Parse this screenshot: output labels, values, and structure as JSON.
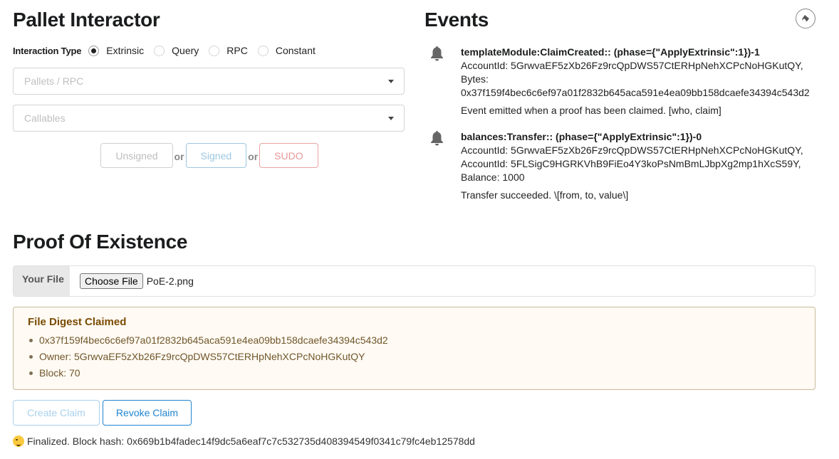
{
  "pallet_interactor": {
    "title": "Pallet Interactor",
    "interaction_type_label": "Interaction Type",
    "interaction_types": [
      {
        "label": "Extrinsic",
        "checked": true
      },
      {
        "label": "Query",
        "checked": false
      },
      {
        "label": "RPC",
        "checked": false
      },
      {
        "label": "Constant",
        "checked": false
      }
    ],
    "pallets_placeholder": "Pallets / RPC",
    "callables_placeholder": "Callables",
    "submit_buttons": {
      "unsigned": "Unsigned",
      "or1": "or",
      "signed": "Signed",
      "or2": "or",
      "sudo": "SUDO"
    }
  },
  "events": {
    "title": "Events",
    "clear_icon": "eraser-icon",
    "items": [
      {
        "icon": "bell-icon",
        "title": "templateModule:ClaimCreated:: (phase={\"ApplyExtrinsic\":1})-1",
        "lines": [
          "AccountId: 5GrwvaEF5zXb26Fz9rcQpDWS57CtERHpNehXCPcNoHGKutQY,",
          "Bytes:",
          "0x37f159f4bec6c6ef97a01f2832b645aca591e4ea09bb158dcaefe34394c543d2"
        ],
        "description": "Event emitted when a proof has been claimed. [who, claim]"
      },
      {
        "icon": "bell-icon",
        "title": "balances:Transfer:: (phase={\"ApplyExtrinsic\":1})-0",
        "lines": [
          "AccountId: 5GrwvaEF5zXb26Fz9rcQpDWS57CtERHpNehXCPcNoHGKutQY,",
          "AccountId: 5FLSigC9HGRKVhB9FiEo4Y3koPsNmBmLJbpXg2mp1hXcS59Y,",
          "Balance: 1000"
        ],
        "description": "Transfer succeeded. \\[from, to, value\\]"
      }
    ]
  },
  "proof_of_existence": {
    "title": "Proof Of Existence",
    "file_label": "Your File",
    "choose_file_label": "Choose File",
    "file_name": "PoE-2.png",
    "claimed": {
      "header": "File Digest Claimed",
      "items": [
        "0x37f159f4bec6c6ef97a01f2832b645aca591e4ea09bb158dcaefe34394c543d2",
        "Owner: 5GrwvaEF5zXb26Fz9rcQpDWS57CtERHpNehXCPcNoHGKutQY",
        "Block: 70"
      ]
    },
    "create_claim_label": "Create Claim",
    "revoke_claim_label": "Revoke Claim",
    "status_icon": "wink-emoji-icon",
    "status_text": "Finalized. Block hash: 0x669b1b4fadec14f9dc5a6eaf7c7c532735d408394549f0341c79fc4eb12578dd"
  },
  "colors": {
    "primary": "#2185d0",
    "warning_bg": "#fffaf3",
    "warning_text": "#573a08",
    "sudo": "#db2828"
  }
}
